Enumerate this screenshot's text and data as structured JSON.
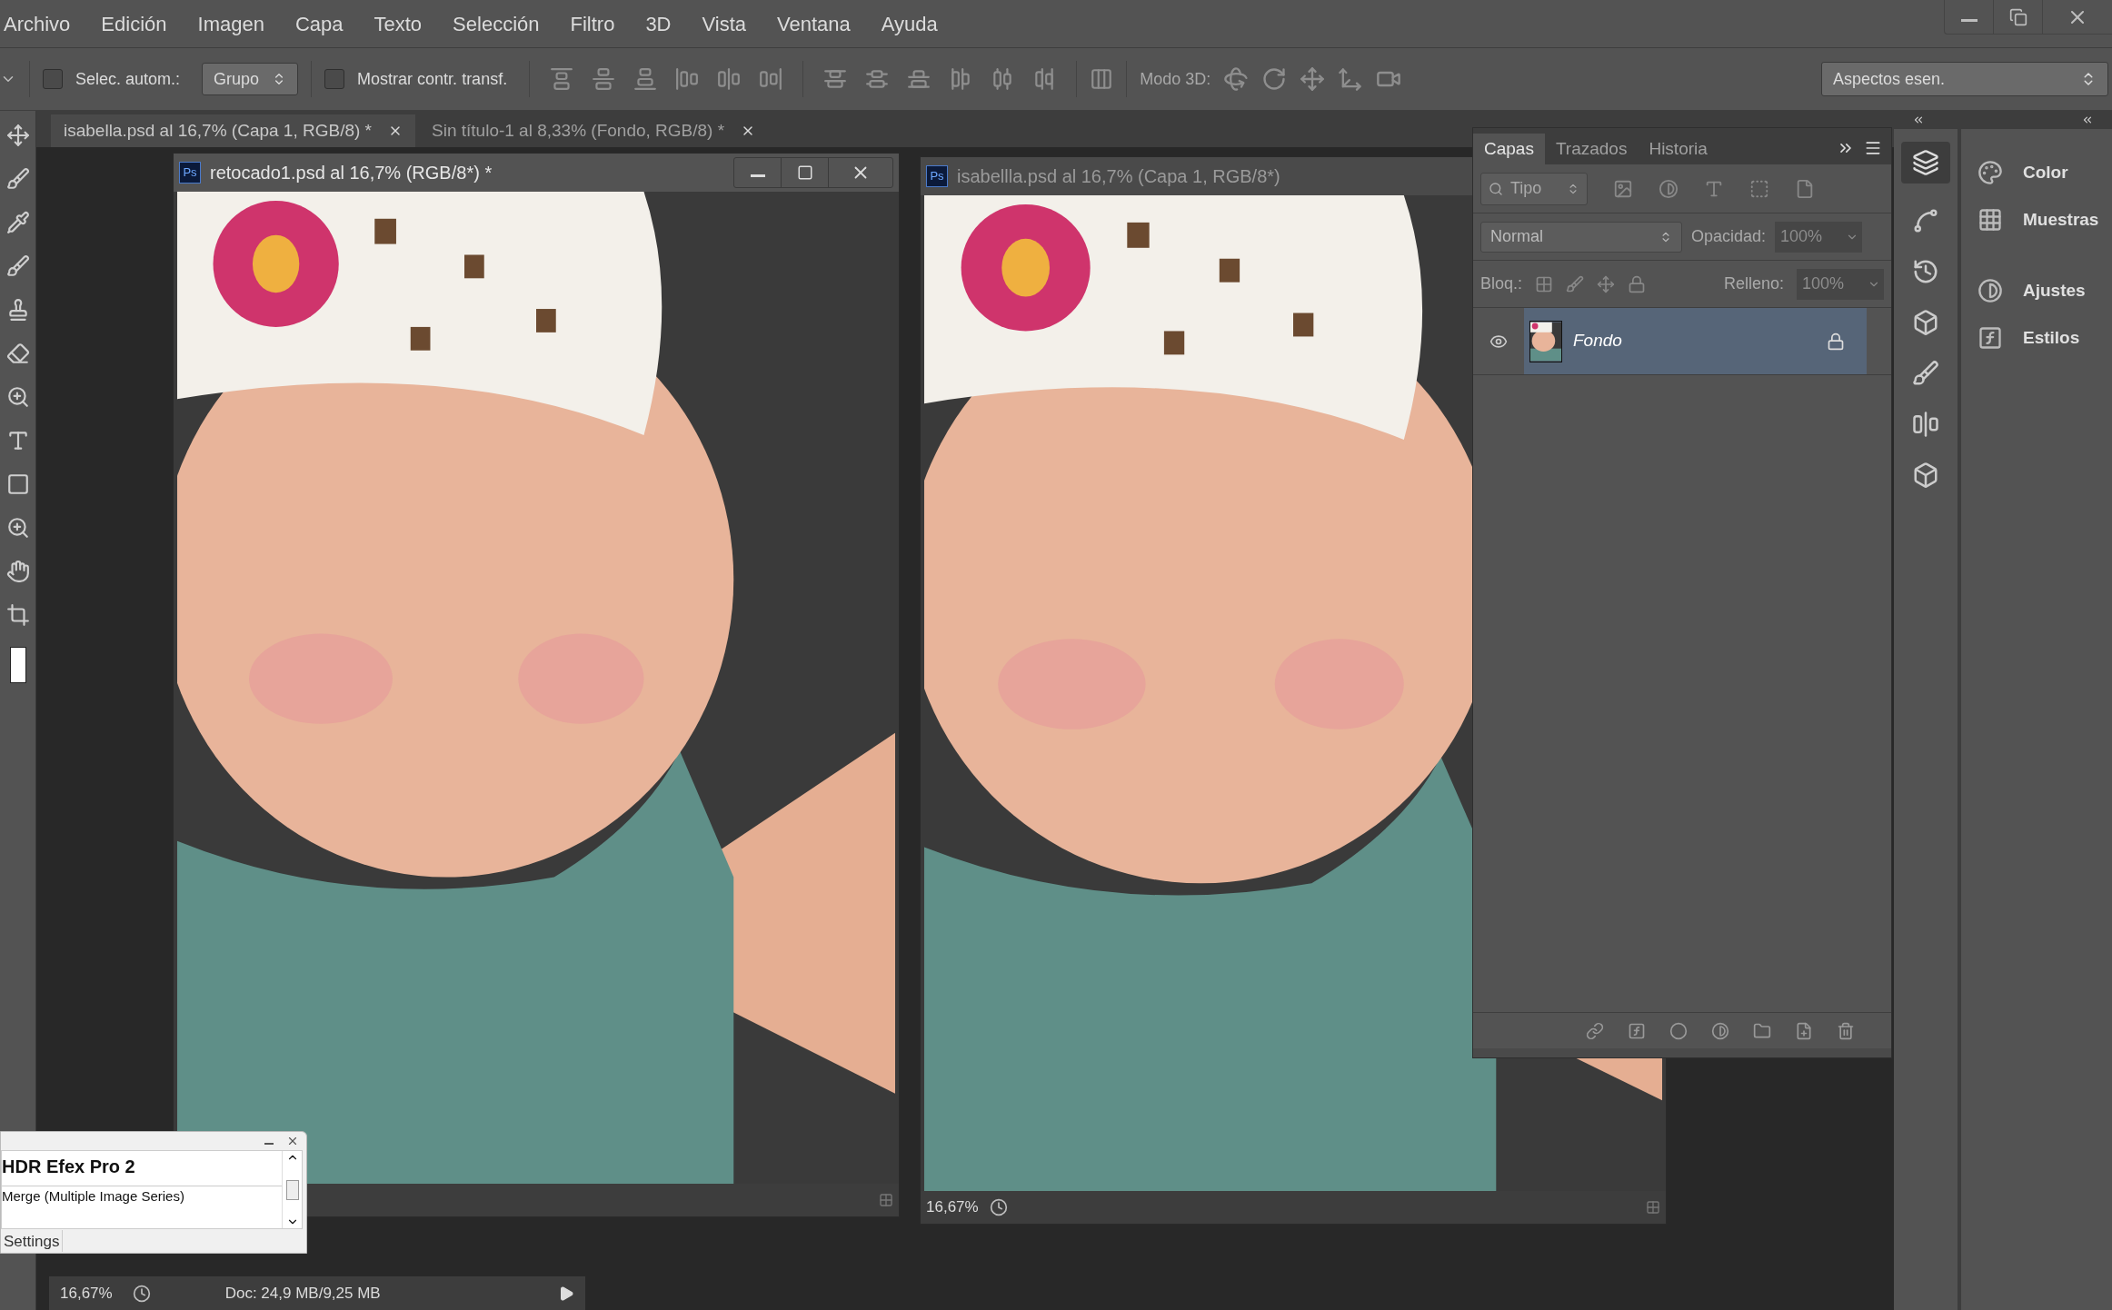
{
  "menu": [
    "Archivo",
    "Edición",
    "Imagen",
    "Capa",
    "Texto",
    "Selección",
    "Filtro",
    "3D",
    "Vista",
    "Ventana",
    "Ayuda"
  ],
  "options_bar": {
    "auto_select": {
      "label": "Selec. autom.:",
      "checked": false
    },
    "auto_select_mode": "Grupo",
    "show_transform": {
      "label": "Mostrar contr. transf.",
      "checked": false
    },
    "mode_3d_label": "Modo 3D:",
    "workspace": "Aspectos esen."
  },
  "document_tabs": [
    {
      "label": "isabella.psd al 16,7% (Capa 1, RGB/8) *",
      "selected": true
    },
    {
      "label": "Sin título-1 al 8,33% (Fondo, RGB/8) *",
      "selected": false
    }
  ],
  "windows": [
    {
      "badge": "Ps",
      "title": "retocado1.psd al 16,7% (RGB/8*) *",
      "active": true
    },
    {
      "badge": "Ps",
      "title": "isabellla.psd al 16,7% (Capa 1, RGB/8*)",
      "active": false,
      "zoom": "16,67%"
    }
  ],
  "layers_panel": {
    "tabs": [
      {
        "label": "Capas",
        "selected": true
      },
      {
        "label": "Trazados",
        "selected": false
      },
      {
        "label": "Historia",
        "selected": false
      }
    ],
    "filter": "Tipo",
    "blend_mode": "Normal",
    "opacity_label": "Opacidad:",
    "opacity": {
      "value": "100%",
      "disabled": true
    },
    "lock_label": "Bloq.:",
    "fill_label": "Relleno:",
    "fill": {
      "value": "100%",
      "disabled": true
    },
    "layers": [
      {
        "name": "Fondo",
        "visible": true,
        "selected": true,
        "locked": true
      }
    ]
  },
  "dock": [
    {
      "label": "Color"
    },
    {
      "label": "Muestras"
    },
    {
      "label": "Ajustes"
    },
    {
      "label": "Estilos"
    }
  ],
  "plugin_window": {
    "title": "HDR Efex Pro 2",
    "item": "Merge (Multiple Image Series)",
    "button": "Settings"
  },
  "status_bar": {
    "zoom": "16,67%",
    "doc": "Doc: 24,9 MB/9,25 MB"
  }
}
